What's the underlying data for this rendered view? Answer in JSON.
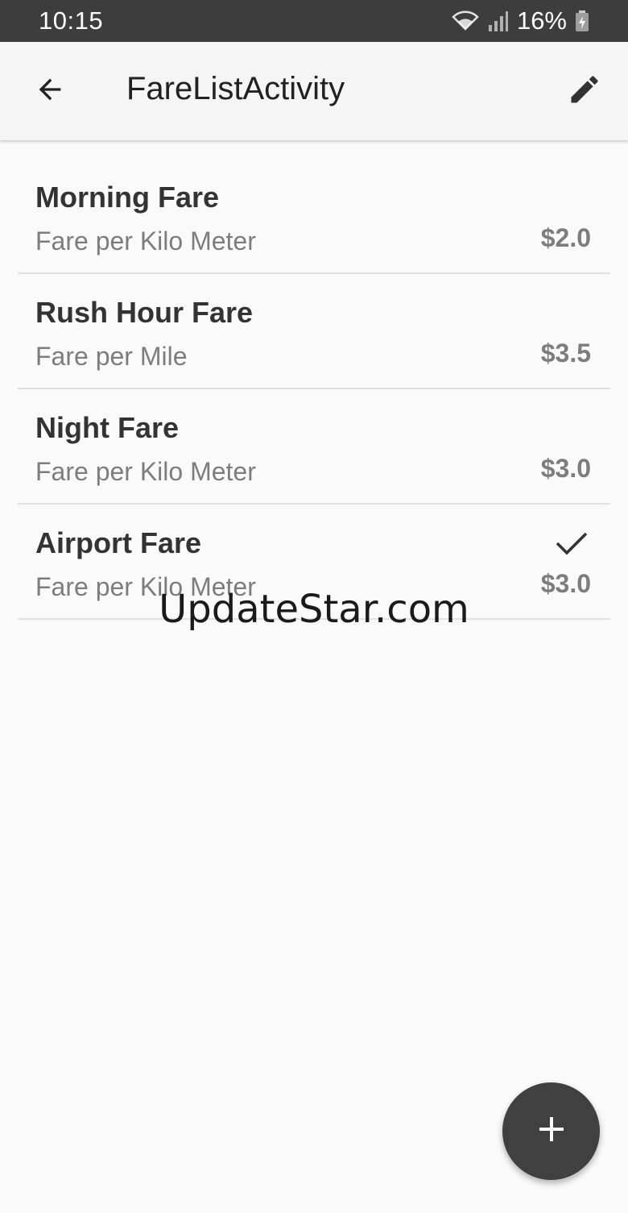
{
  "status_bar": {
    "time": "10:15",
    "battery": "16%",
    "icons": [
      "wifi-icon",
      "signal-icon",
      "battery-charging-icon"
    ]
  },
  "app_bar": {
    "title": "FareListActivity",
    "back_icon": "arrow-back-icon",
    "edit_icon": "pencil-icon"
  },
  "fares": [
    {
      "title": "Morning Fare",
      "subtitle": "Fare per Kilo Meter",
      "price": "$2.0",
      "selected": false
    },
    {
      "title": "Rush Hour Fare",
      "subtitle": "Fare per Mile",
      "price": "$3.5",
      "selected": false
    },
    {
      "title": "Night Fare",
      "subtitle": "Fare per Kilo Meter",
      "price": "$3.0",
      "selected": false
    },
    {
      "title": "Airport Fare",
      "subtitle": "Fare per Kilo Meter",
      "price": "$3.0",
      "selected": true
    }
  ],
  "watermark": "UpdateStar.com",
  "fab": {
    "icon": "plus-icon"
  },
  "colors": {
    "status_bar_bg": "#3d3d3d",
    "app_bar_bg": "#f5f5f5",
    "page_bg": "#fafafa",
    "fab_bg": "#404040",
    "title_text": "#333333",
    "secondary_text": "#7d7d7d"
  }
}
